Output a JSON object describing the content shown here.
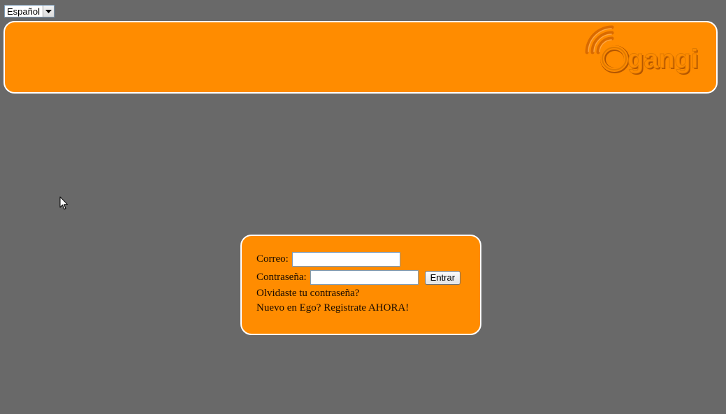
{
  "language_selector": {
    "value": "Español",
    "icon": "chevron-down-icon"
  },
  "header": {
    "logo_text": "Ogangi",
    "brand_color": "#ff8c00",
    "background_color": "#696969"
  },
  "login": {
    "email_label": "Correo:",
    "email_value": "",
    "password_label": "Contraseña:",
    "password_value": "",
    "submit_label": "Entrar",
    "forgot_link": "Olvidaste tu contraseña?",
    "register_link": "Nuevo en Ego? Registrate AHORA!"
  }
}
